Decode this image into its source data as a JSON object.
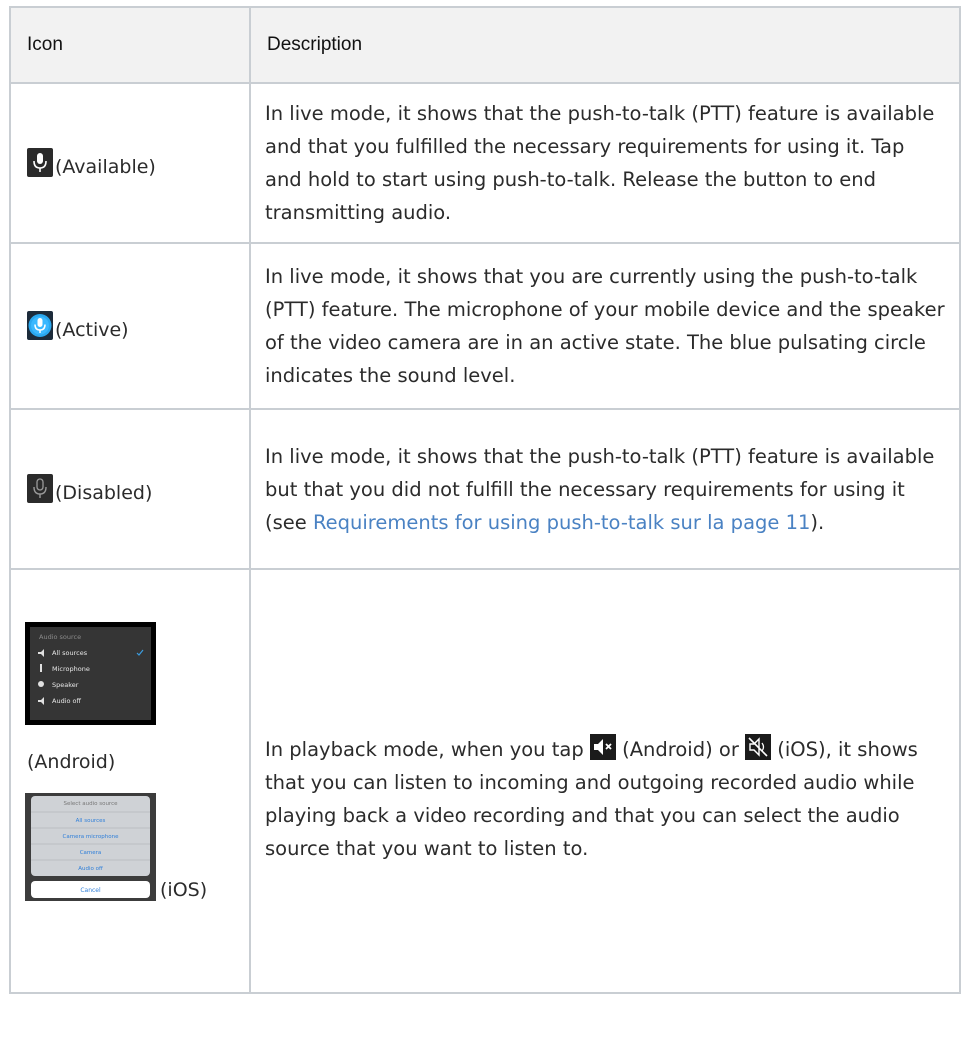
{
  "table": {
    "headers": [
      "Icon",
      "Description"
    ],
    "rows": [
      {
        "icon_name": "mic-available-icon",
        "icon_label": "(Available)",
        "description": "In live mode, it shows that the push-to-talk (PTT) feature is available and that you fulfilled the necessary requirements for using it. Tap and hold to start using push-to-talk. Release the button to end transmitting audio."
      },
      {
        "icon_name": "mic-active-icon",
        "icon_label": "(Active)",
        "description": "In live mode, it shows that you are currently using the push-to-talk (PTT) feature. The microphone of your mobile device and the speaker of the video camera are in an active state. The blue pulsating circle indicates the sound level."
      },
      {
        "icon_name": "mic-disabled-icon",
        "icon_label": "(Disabled)",
        "description_before": "In live mode, it shows that the push-to-talk (PTT) feature is available but that you did not fulfill the necessary requirements for using it (see ",
        "link_text": "Requirements for using push-to-talk sur la page 11",
        "description_after": ")."
      },
      {
        "android_label": "(Android)",
        "ios_label": "(iOS)",
        "android_menu": {
          "title": "Audio source",
          "items": [
            "All sources",
            "Microphone",
            "Speaker",
            "Audio off"
          ]
        },
        "ios_menu": {
          "title": "Select audio source",
          "items": [
            "All sources",
            "Camera microphone",
            "Camera",
            "Audio off"
          ],
          "cancel": "Cancel"
        },
        "desc_1": "In playback mode, when you tap ",
        "desc_2": " (Android) or ",
        "desc_3": " (iOS), it shows that you can listen to incoming and outgoing recorded audio while playing back a video recording and that you can select the audio source that you want to listen to."
      }
    ]
  },
  "colors": {
    "border": "#c9ced3",
    "header_bg": "#f2f2f2",
    "link": "#4a82c3",
    "active_blue": "#2aa7ee"
  }
}
